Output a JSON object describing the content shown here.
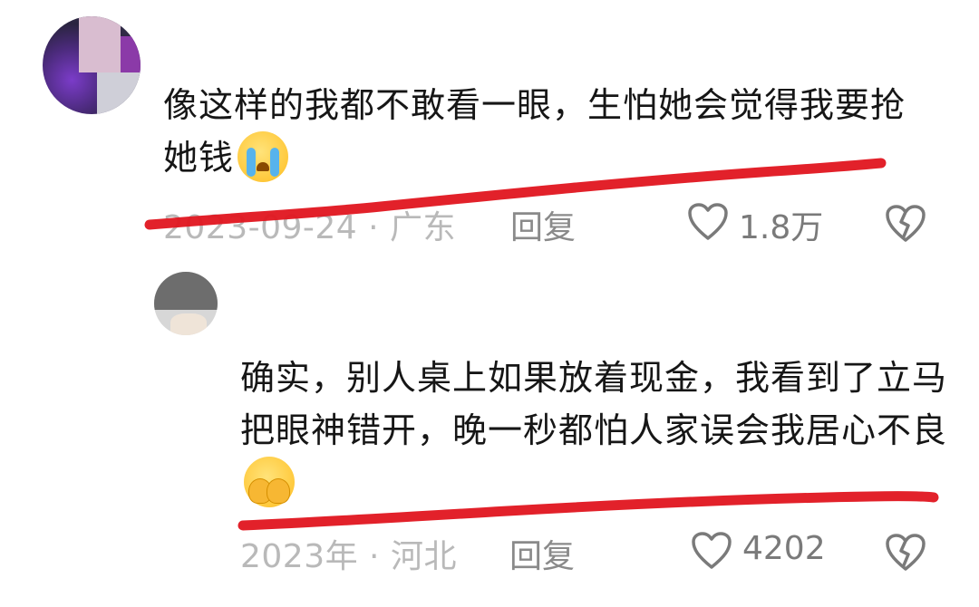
{
  "comments": [
    {
      "text": "像这样的我都不敢看一眼，生怕她会觉得我要抢她钱",
      "emoji": "loudly-crying-face",
      "date_location": "2023-09-24 · 广东",
      "reply_label": "回复",
      "like_count": "1.8万"
    },
    {
      "text": "确实，别人桌上如果放着现金，我看到了立马把眼神错开，晚一秒都怕人家误会我居心不良",
      "emoji": "face-covering-eyes",
      "date_location": "2023年 · 河北",
      "reply_label": "回复",
      "like_count": "4202"
    }
  ],
  "colors": {
    "underline": "#e0151f",
    "meta_text": "#b9b9b9",
    "icon": "#7a7a7a"
  }
}
